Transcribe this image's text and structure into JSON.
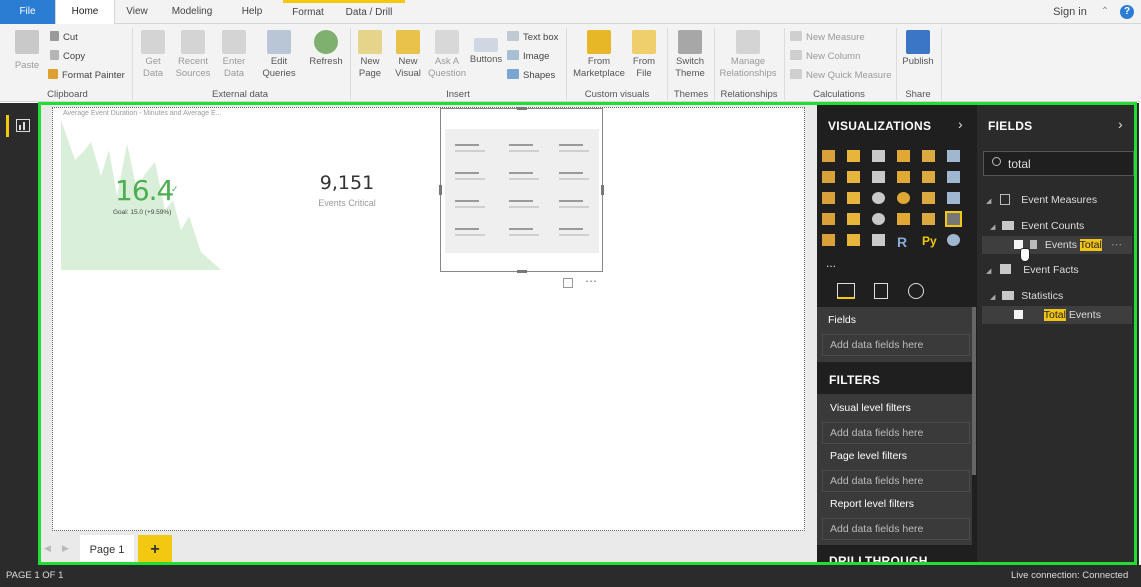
{
  "tabs": [
    "File",
    "Home",
    "View",
    "Modeling",
    "Help",
    "Format",
    "Data / Drill"
  ],
  "account": {
    "signin": "Sign in"
  },
  "ribbon": {
    "clipboard": {
      "paste": "Paste",
      "cut": "Cut",
      "copy": "Copy",
      "format_painter": "Format Painter",
      "group": "Clipboard"
    },
    "external": {
      "get_data": "Get\nData",
      "recent": "Recent\nSources",
      "enter": "Enter\nData",
      "edit": "Edit\nQueries",
      "refresh": "Refresh",
      "group": "External data"
    },
    "insert": {
      "new_page": "New\nPage",
      "new_visual": "New\nVisual",
      "ask": "Ask A\nQuestion",
      "buttons": "Buttons",
      "text_box": "Text box",
      "image": "Image",
      "shapes": "Shapes",
      "group": "Insert"
    },
    "custom": {
      "marketplace": "From\nMarketplace",
      "file": "From\nFile",
      "group": "Custom visuals"
    },
    "themes": {
      "switch": "Switch\nTheme",
      "group": "Themes"
    },
    "relationships": {
      "manage": "Manage\nRelationships",
      "group": "Relationships"
    },
    "calculations": {
      "measure": "New Measure",
      "column": "New Column",
      "quick": "New Quick Measure",
      "group": "Calculations"
    },
    "share": {
      "publish": "Publish",
      "group": "Share"
    }
  },
  "canvas": {
    "kpi_title": "Average Event Duration - Minutes and Average E...",
    "kpi_value": "16.4",
    "kpi_goal": "Goal: 15.0 (+9.59%)",
    "card_value": "9,151",
    "card_label": "Events Critical",
    "page_tab": "Page 1",
    "add_page": "+"
  },
  "visualizations": {
    "title": "VISUALIZATIONS",
    "fields_tab": "Fields",
    "add_fields": "Add data fields here",
    "filters_title": "FILTERS",
    "visual_filters": "Visual level filters",
    "page_filters": "Page level filters",
    "report_filters": "Report level filters",
    "drillthrough": "DRILLTHROUGH",
    "more": "..."
  },
  "fields": {
    "title": "FIELDS",
    "search": "total",
    "tree": {
      "event_measures": "Event Measures",
      "event_counts": "Event Counts",
      "events_total_a": "Events ",
      "events_total_b": "Total",
      "event_facts": "Event Facts",
      "statistics": "Statistics",
      "total_events_a": "Total",
      "total_events_b": " Events"
    }
  },
  "status": {
    "page": "PAGE 1 OF 1",
    "connection": "Live connection: Connected"
  },
  "colors": {
    "accent": "#f2c811",
    "highlight": "#f0c419",
    "selection": "#22dd33",
    "kpi_green": "#4caf50",
    "file_tab": "#2b7cd3"
  }
}
